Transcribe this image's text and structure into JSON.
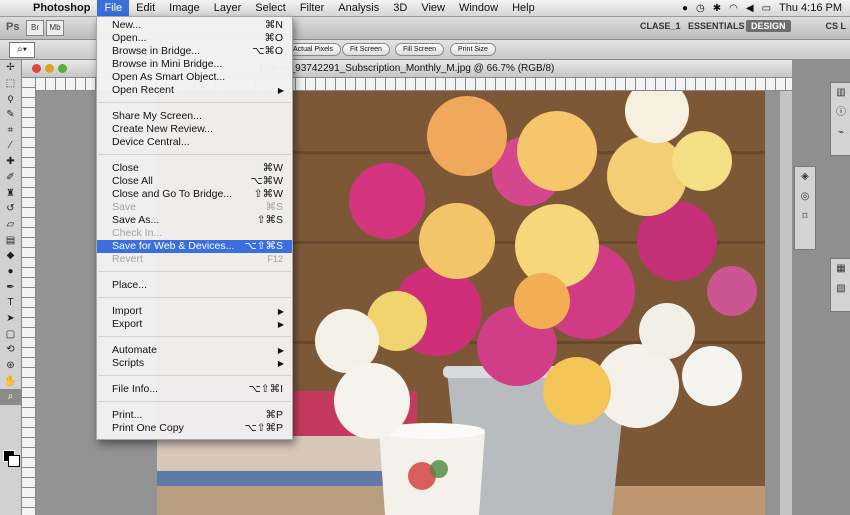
{
  "menubar": {
    "app": "Photoshop",
    "items": [
      "File",
      "Edit",
      "Image",
      "Layer",
      "Select",
      "Filter",
      "Analysis",
      "3D",
      "View",
      "Window",
      "Help"
    ],
    "active": "File",
    "clock": "Thu 4:16 PM"
  },
  "appbar": {
    "logo": "Ps",
    "btn_br": "Br",
    "btn_mb": "Mb",
    "workspace_1": "CLASE_1",
    "workspace_2": "ESSENTIALS",
    "workspace_3": "DESIGN",
    "cs_live": "CS L"
  },
  "options": {
    "btn_actual": "Actual Pixels",
    "btn_fit": "Fit Screen",
    "btn_fill": "Fill Screen",
    "btn_print": "Print Size"
  },
  "document": {
    "title": "Fotolia_93742291_Subscription_Monthly_M.jpg @ 66.7% (RGB/8)"
  },
  "file_menu": {
    "items": [
      {
        "label": "New...",
        "shortcut": "⌘N"
      },
      {
        "label": "Open...",
        "shortcut": "⌘O"
      },
      {
        "label": "Browse in Bridge...",
        "shortcut": "⌥⌘O"
      },
      {
        "label": "Browse in Mini Bridge..."
      },
      {
        "label": "Open As Smart Object..."
      },
      {
        "label": "Open Recent",
        "submenu": true
      },
      {
        "label": "Share My Screen..."
      },
      {
        "label": "Create New Review..."
      },
      {
        "label": "Device Central..."
      },
      {
        "label": "Close",
        "shortcut": "⌘W"
      },
      {
        "label": "Close All",
        "shortcut": "⌥⌘W"
      },
      {
        "label": "Close and Go To Bridge...",
        "shortcut": "⇧⌘W"
      },
      {
        "label": "Save",
        "shortcut": "⌘S",
        "disabled": true
      },
      {
        "label": "Save As...",
        "shortcut": "⇧⌘S"
      },
      {
        "label": "Check In...",
        "disabled": true
      },
      {
        "label": "Save for Web & Devices...",
        "shortcut": "⌥⇧⌘S",
        "highlighted": true
      },
      {
        "label": "Revert",
        "shortcut": "F12",
        "disabled": true
      },
      {
        "label": "Place..."
      },
      {
        "label": "Import",
        "submenu": true
      },
      {
        "label": "Export",
        "submenu": true
      },
      {
        "label": "Automate",
        "submenu": true
      },
      {
        "label": "Scripts",
        "submenu": true
      },
      {
        "label": "File Info...",
        "shortcut": "⌥⇧⌘I"
      },
      {
        "label": "Print...",
        "shortcut": "⌘P"
      },
      {
        "label": "Print One Copy",
        "shortcut": "⌥⇧⌘P"
      }
    ]
  },
  "colors": {
    "menu_highlight": "#3b6fe0",
    "active_menu": "#3a6fd9"
  }
}
